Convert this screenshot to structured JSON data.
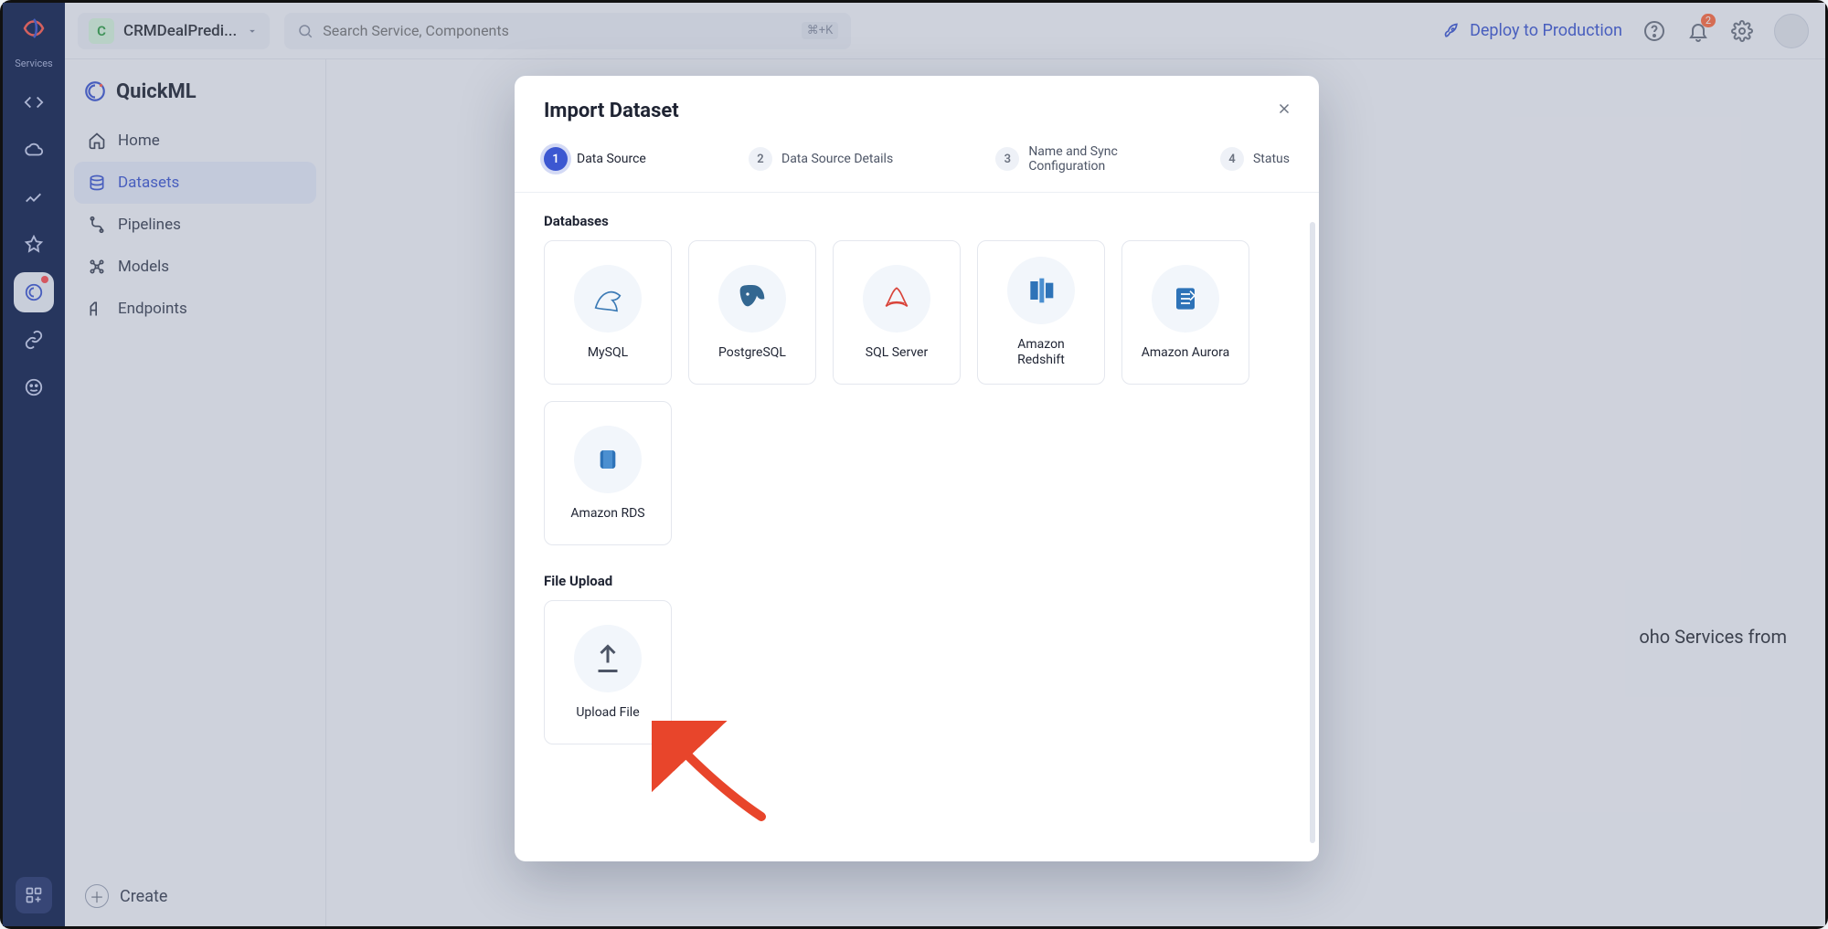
{
  "rail": {
    "services_label": "Services"
  },
  "topbar": {
    "project_initial": "C",
    "project_name": "CRMDealPredi...",
    "search_placeholder": "Search Service, Components",
    "search_shortcut": "⌘+K",
    "deploy_label": "Deploy to Production",
    "notification_count": "2"
  },
  "sidebar": {
    "app_title": "QuickML",
    "items": [
      {
        "label": "Home"
      },
      {
        "label": "Datasets"
      },
      {
        "label": "Pipelines"
      },
      {
        "label": "Models"
      },
      {
        "label": "Endpoints"
      }
    ],
    "create_label": "Create"
  },
  "background_hint": "oho Services from",
  "modal": {
    "title": "Import Dataset",
    "steps": [
      {
        "num": "1",
        "label": "Data Source"
      },
      {
        "num": "2",
        "label": "Data Source Details"
      },
      {
        "num": "3",
        "label": "Name and Sync Configuration"
      },
      {
        "num": "4",
        "label": "Status"
      }
    ],
    "section_databases": "Databases",
    "section_fileupload": "File Upload",
    "databases": [
      {
        "label": "MySQL"
      },
      {
        "label": "PostgreSQL"
      },
      {
        "label": "SQL Server"
      },
      {
        "label": "Amazon Redshift"
      },
      {
        "label": "Amazon Aurora"
      },
      {
        "label": "Amazon RDS"
      }
    ],
    "uploads": [
      {
        "label": "Upload File"
      }
    ]
  }
}
